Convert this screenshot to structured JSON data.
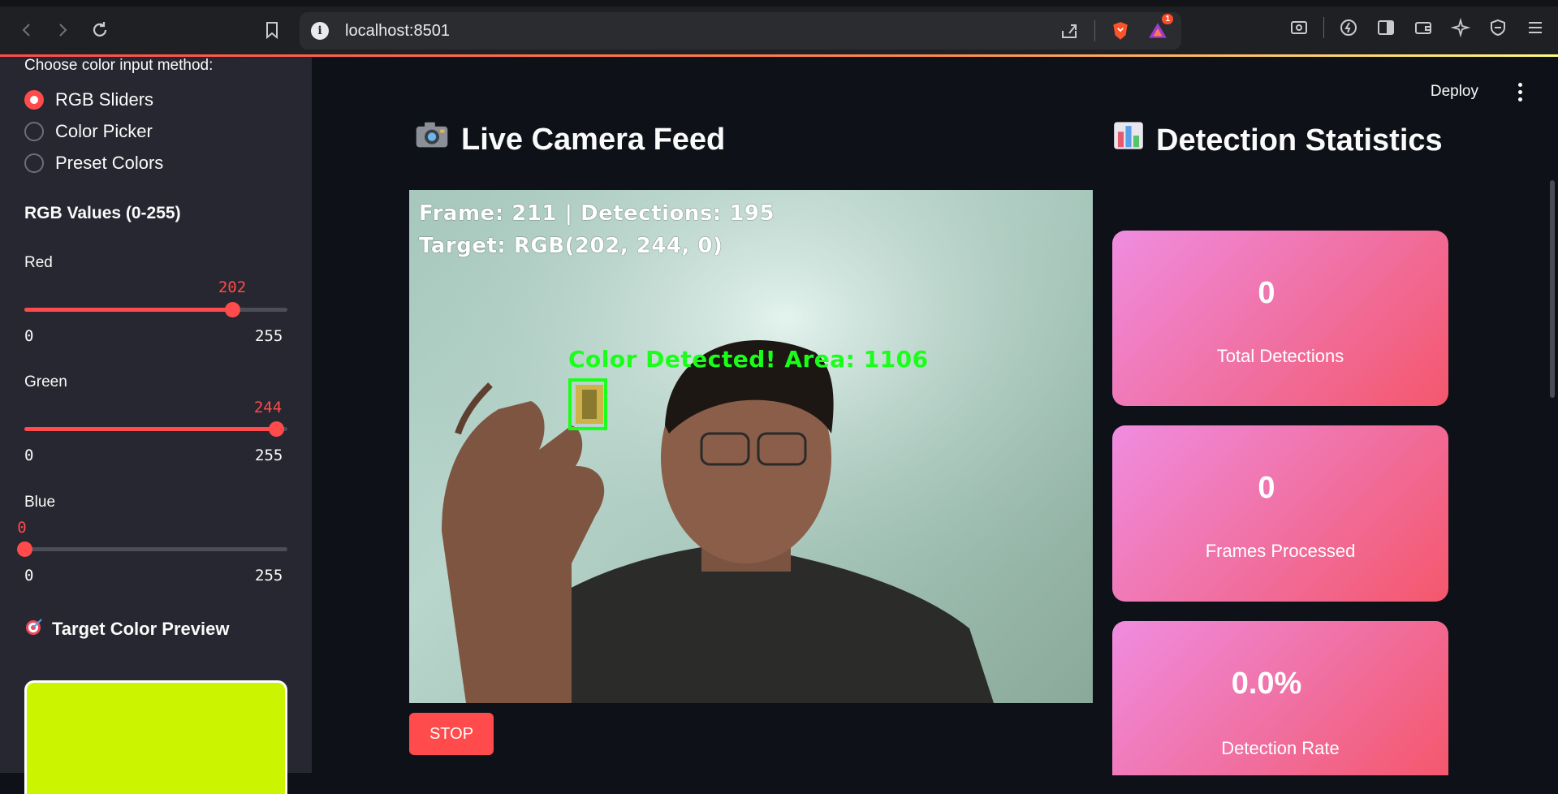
{
  "browser": {
    "url": "localhost:8501",
    "notification_count": "1"
  },
  "sidebar": {
    "input_method_label": "Choose color input method:",
    "input_methods": [
      {
        "label": "RGB Sliders",
        "selected": true
      },
      {
        "label": "Color Picker",
        "selected": false
      },
      {
        "label": "Preset Colors",
        "selected": false
      }
    ],
    "rgb_heading": "RGB Values (0-255)",
    "sliders": [
      {
        "label": "Red",
        "value": "202",
        "min": "0",
        "max": "255"
      },
      {
        "label": "Green",
        "value": "244",
        "min": "0",
        "max": "255"
      },
      {
        "label": "Blue",
        "value": "0",
        "min": "0",
        "max": "255"
      }
    ],
    "preview_heading": "Target Color Preview",
    "preview_icon": "target-emoji",
    "preview_color": "#caf400"
  },
  "main": {
    "deploy_label": "Deploy",
    "camera_title": "Live Camera Feed",
    "camera_icon": "camera-emoji",
    "overlay": {
      "line1": "Frame: 211 | Detections: 195",
      "line2": "Target: RGB(202, 244, 0)",
      "detection_text": "Color Detected! Area: 1106"
    },
    "stop_label": "STOP",
    "stats_title": "Detection Statistics",
    "stats_icon": "bar-chart-emoji",
    "stats": [
      {
        "value": "0",
        "label": "Total Detections"
      },
      {
        "value": "0",
        "label": "Frames Processed"
      },
      {
        "value": "0.0%",
        "label": "Detection Rate"
      }
    ],
    "accent_color": "#ff4b4b"
  }
}
